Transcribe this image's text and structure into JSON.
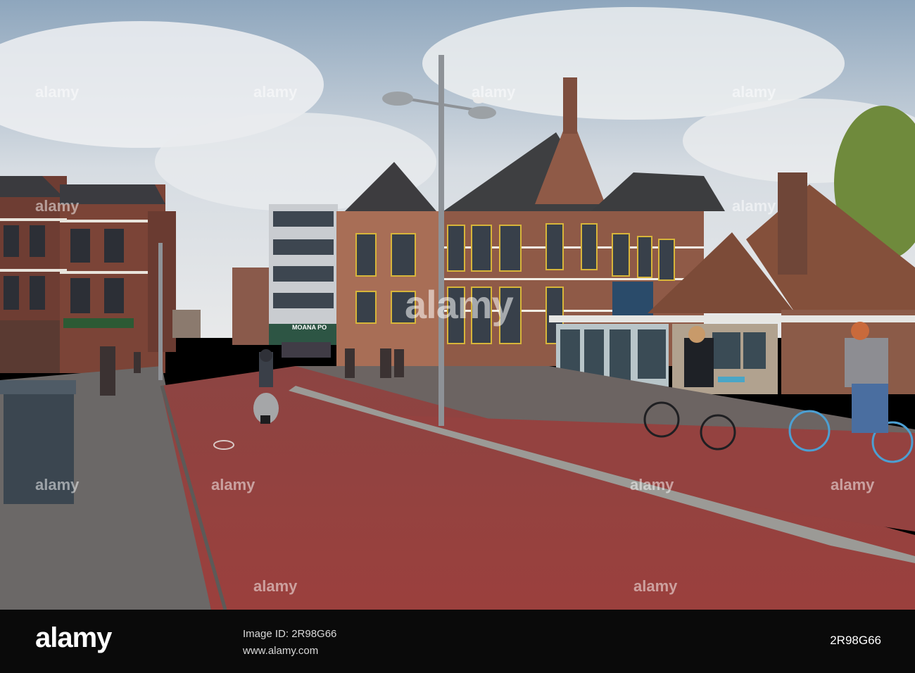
{
  "watermark": {
    "brand": "alamy",
    "repeat": [
      "alamy",
      "alamy",
      "alamy",
      "alamy",
      "alamy",
      "alamy",
      "alamy",
      "alamy",
      "alamy",
      "alamy",
      "alamy",
      "alamy"
    ]
  },
  "footer": {
    "logo": "alamy",
    "line1": "Image ID: 2R98G66",
    "line2": "www.alamy.com",
    "image_id": "2R98G66"
  },
  "signs": {
    "shop": "MOANA PO"
  },
  "colors": {
    "sky": "#c9d3dc",
    "cycle_path": "#9a3f3c",
    "brick": "#8a5a48",
    "footer_bg": "#0a0a0a"
  }
}
